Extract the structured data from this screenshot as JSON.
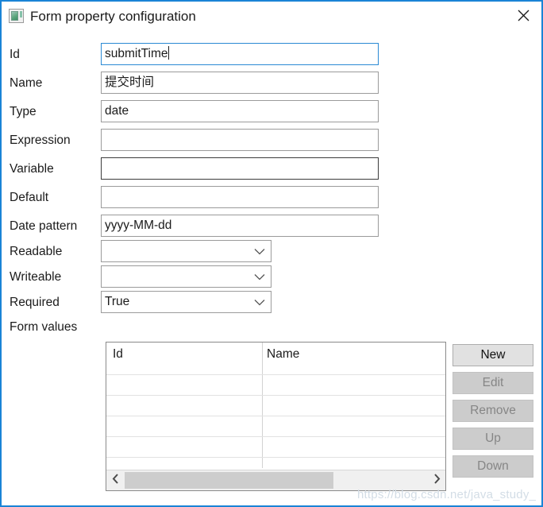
{
  "window": {
    "title": "Form property configuration",
    "icon": "form-property-icon",
    "close_icon": "close-icon",
    "border_color": "#1a84d6"
  },
  "form": {
    "fields": [
      {
        "label": "Id",
        "value": "submitTime",
        "kind": "text",
        "focused": true,
        "strong": false,
        "caret": true
      },
      {
        "label": "Name",
        "value": "提交时间",
        "kind": "text",
        "focused": false,
        "strong": false,
        "caret": false
      },
      {
        "label": "Type",
        "value": "date",
        "kind": "text",
        "focused": false,
        "strong": false,
        "caret": false
      },
      {
        "label": "Expression",
        "value": "",
        "kind": "text",
        "focused": false,
        "strong": false,
        "caret": false
      },
      {
        "label": "Variable",
        "value": "",
        "kind": "text",
        "focused": false,
        "strong": true,
        "caret": false
      },
      {
        "label": "Default",
        "value": "",
        "kind": "text",
        "focused": false,
        "strong": false,
        "caret": false
      },
      {
        "label": "Date pattern",
        "value": "yyyy-MM-dd",
        "kind": "text",
        "focused": false,
        "strong": false,
        "caret": false
      },
      {
        "label": "Readable",
        "value": "",
        "kind": "select",
        "focused": false,
        "strong": false,
        "caret": false
      },
      {
        "label": "Writeable",
        "value": "",
        "kind": "select",
        "focused": false,
        "strong": false,
        "caret": false
      },
      {
        "label": "Required",
        "value": "True",
        "kind": "select",
        "focused": false,
        "strong": false,
        "caret": false
      }
    ],
    "form_values_label": "Form values"
  },
  "table": {
    "columns": [
      "Id",
      "Name"
    ],
    "rows": [],
    "empty_row_count": 5,
    "scrollbar": {
      "left_arrow_icon": "chevron-left-icon",
      "right_arrow_icon": "chevron-right-icon",
      "thumb_fraction": 0.69
    }
  },
  "buttons": [
    {
      "label": "New",
      "enabled": true
    },
    {
      "label": "Edit",
      "enabled": false
    },
    {
      "label": "Remove",
      "enabled": false
    },
    {
      "label": "Up",
      "enabled": false
    },
    {
      "label": "Down",
      "enabled": false
    }
  ],
  "watermark": "https://blog.csdn.net/java_study_"
}
